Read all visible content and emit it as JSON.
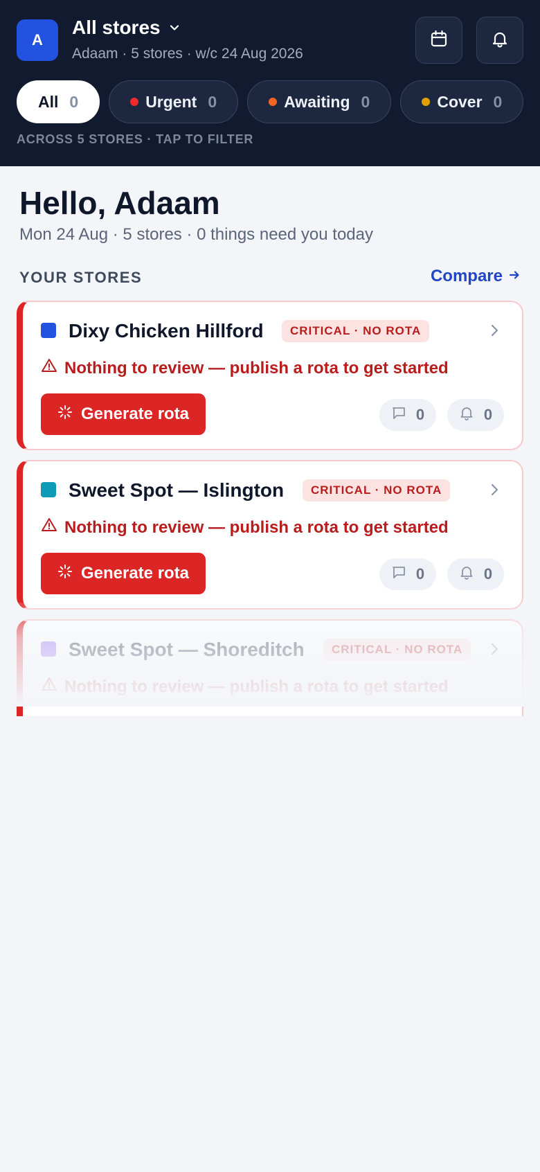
{
  "header": {
    "avatar_initial": "A",
    "store_switch_label": "All stores",
    "subtitle": "Adaam · 5 stores · w/c 24 Aug 2026",
    "filters": [
      {
        "label": "All",
        "count": "0"
      },
      {
        "label": "Urgent",
        "count": "0",
        "dot_color": "#ef2b2b"
      },
      {
        "label": "Awaiting",
        "count": "0",
        "dot_color": "#f26522"
      },
      {
        "label": "Cover",
        "count": "0",
        "dot_color": "#e0a100"
      }
    ],
    "hint": "ACROSS 5 STORES · TAP TO FILTER"
  },
  "main": {
    "greeting": "Hello, Adaam",
    "summary": "Mon 24 Aug · 5 stores · 0 things need you today",
    "section_title": "YOUR STORES",
    "compare_label": "Compare"
  },
  "stores": [
    {
      "name": "Dixy Chicken Hillford",
      "color": "#2452e0",
      "badge": "CRITICAL · NO ROTA",
      "warning": "Nothing to review — publish a rota to get started",
      "action_label": "Generate rota",
      "messages": "0",
      "alerts": "0"
    },
    {
      "name": "Sweet Spot — Islington",
      "color": "#0e9bb5",
      "badge": "CRITICAL · NO ROTA",
      "warning": "Nothing to review — publish a rota to get started",
      "action_label": "Generate rota",
      "messages": "0",
      "alerts": "0"
    },
    {
      "name": "Sweet Spot — Shoreditch",
      "color": "#8b5cf6",
      "badge": "CRITICAL · NO ROTA",
      "warning": "Nothing to review — publish a rota to get started"
    }
  ],
  "colors": {
    "header_bg": "#111a2e",
    "accent": "#2452e0",
    "critical": "#dc2626",
    "page_bg": "#f3f5f9"
  }
}
